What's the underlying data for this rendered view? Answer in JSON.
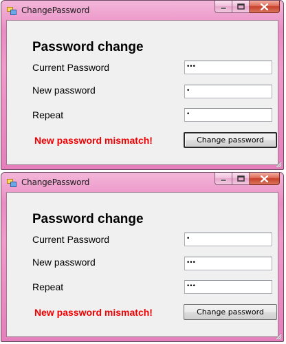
{
  "windows": [
    {
      "title": "ChangePassword",
      "heading": "Password change",
      "labels": {
        "current": "Current Password",
        "new": "New password",
        "repeat": "Repeat"
      },
      "fields": {
        "current": "•••",
        "new": "•",
        "repeat": "•"
      },
      "error": "New password mismatch!",
      "button": "Change password",
      "button_focused": true
    },
    {
      "title": "ChangePassword",
      "heading": "Password change",
      "labels": {
        "current": "Current Password",
        "new": "New password",
        "repeat": "Repeat"
      },
      "fields": {
        "current": "•",
        "new": "•••",
        "repeat": "•••"
      },
      "error": "New password mismatch!",
      "button": "Change password",
      "button_focused": false
    }
  ],
  "icons": {
    "app": "app-window-icon",
    "minimize": "minimize-icon",
    "maximize": "maximize-icon",
    "close": "close-icon",
    "grip": "resize-grip-icon"
  },
  "colors": {
    "title_bar": "#e98cc3",
    "error_text": "#ee0000",
    "client_bg": "#f0f0f0"
  }
}
